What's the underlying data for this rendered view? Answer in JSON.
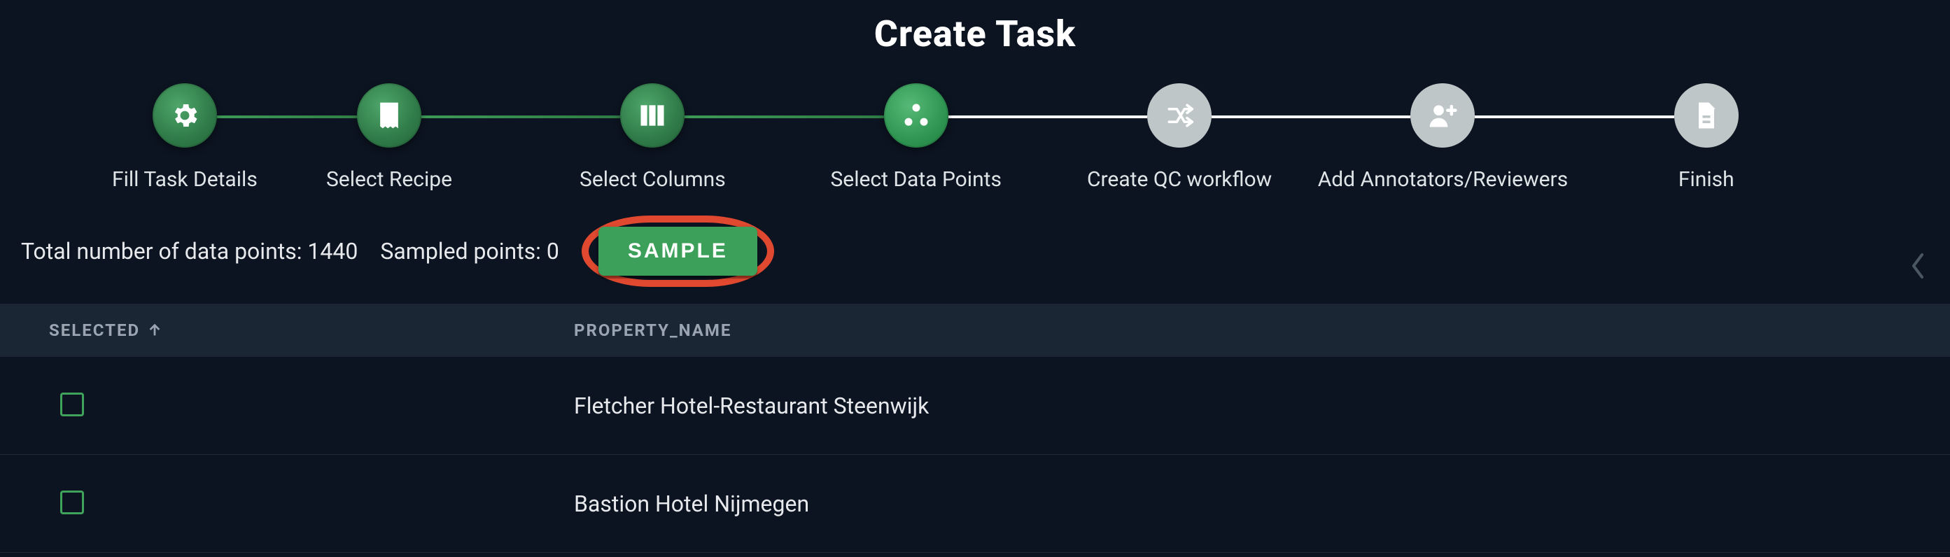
{
  "title": "Create Task",
  "stepper": {
    "steps": [
      {
        "label": "Fill Task Details",
        "state": "done",
        "icon": "gear-icon"
      },
      {
        "label": "Select Recipe",
        "state": "done",
        "icon": "receipt-icon"
      },
      {
        "label": "Select Columns",
        "state": "done",
        "icon": "columns-icon"
      },
      {
        "label": "Select Data Points",
        "state": "current",
        "icon": "nodes-icon"
      },
      {
        "label": "Create QC workflow",
        "state": "pending",
        "icon": "shuffle-icon"
      },
      {
        "label": "Add Annotators/Reviewers",
        "state": "pending",
        "icon": "people-plus-icon"
      },
      {
        "label": "Finish",
        "state": "pending",
        "icon": "file-icon"
      }
    ]
  },
  "summary": {
    "total_label": "Total number of data points:",
    "total_value": "1440",
    "sampled_label": "Sampled points:",
    "sampled_value": "0"
  },
  "actions": {
    "sample_label": "SAMPLE"
  },
  "table": {
    "columns": {
      "selected": "SELECTED",
      "property_name": "PROPERTY_NAME"
    },
    "sort": {
      "column": "selected",
      "dir": "asc"
    },
    "rows": [
      {
        "selected": false,
        "property_name": "Fletcher Hotel-Restaurant Steenwijk"
      },
      {
        "selected": false,
        "property_name": "Bastion Hotel Nijmegen"
      }
    ]
  }
}
